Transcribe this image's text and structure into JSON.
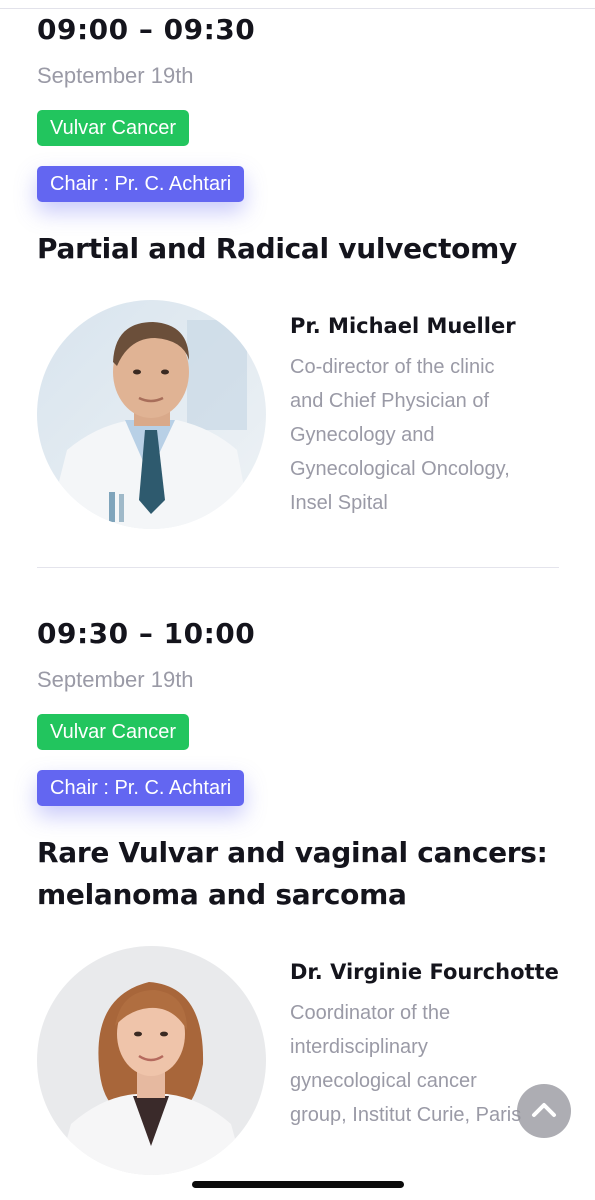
{
  "sessions": [
    {
      "time": "09:00 – 09:30",
      "date": "September 19th",
      "topic": "Vulvar Cancer",
      "chair": "Chair : Pr. C. Achtari",
      "title": "Partial and Radical vulvectomy",
      "speaker": {
        "name": "Pr. Michael Mueller",
        "role_lines": [
          "Co-director of the clinic",
          "and Chief Physician of",
          "Gynecology and",
          "Gynecological Oncology,",
          "Insel Spital"
        ]
      }
    },
    {
      "time": "09:30 – 10:00",
      "date": "September 19th",
      "topic": "Vulvar Cancer",
      "chair": "Chair : Pr. C. Achtari",
      "title_lines": [
        "Rare Vulvar and vaginal cancers:",
        "melanoma and sarcoma"
      ],
      "speaker": {
        "name": "Dr. Virginie Fourchotte",
        "role_lines": [
          "Coordinator of the",
          "interdisciplinary",
          "gynecological cancer",
          "group, Institut Curie, Paris"
        ]
      }
    }
  ],
  "scroll_top_icon": "chevron-up-icon",
  "colors": {
    "topic_pill": "#22c55e",
    "chair_pill": "#6366f1",
    "muted_text": "#9a9aa6"
  }
}
